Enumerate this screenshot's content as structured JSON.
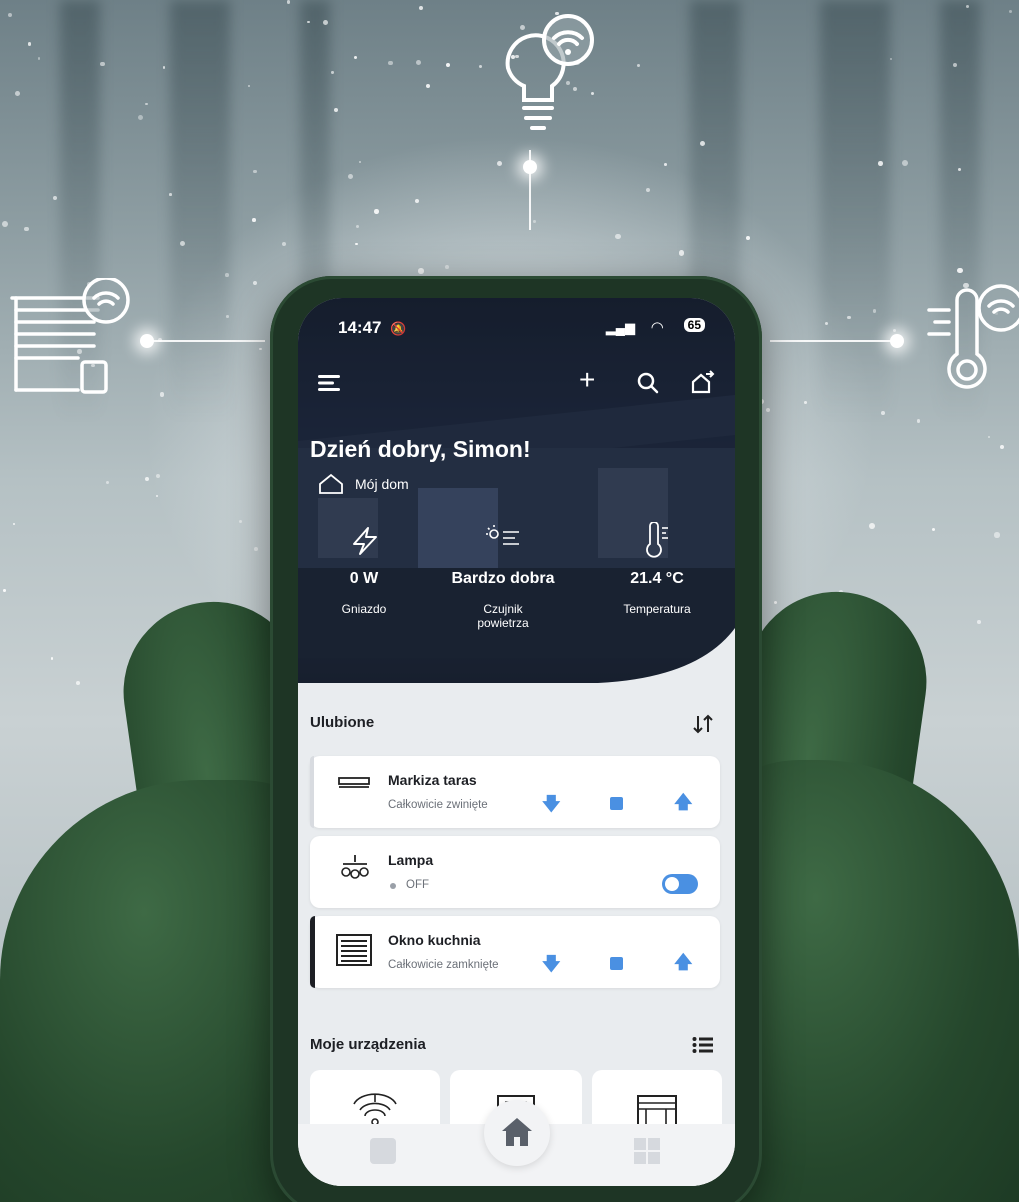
{
  "status": {
    "time": "14:47",
    "battery": "65"
  },
  "header": {
    "greeting": "Dzień dobry, Simon!",
    "home_name": "Mój dom"
  },
  "stats": [
    {
      "icon": "bolt-icon",
      "value": "0 W",
      "label": "Gniazdo"
    },
    {
      "icon": "air-quality-icon",
      "value": "Bardzo dobra",
      "label_line1": "Czujnik",
      "label_line2": "powietrza"
    },
    {
      "icon": "thermometer-icon",
      "value": "21.4 °C",
      "label": "Temperatura"
    }
  ],
  "favorites": {
    "title": "Ulubione",
    "items": [
      {
        "name": "Markiza taras",
        "status": "Całkowicie zwinięte",
        "icon": "awning-icon"
      },
      {
        "name": "Lampa",
        "status": "OFF",
        "icon": "lamp-icon"
      },
      {
        "name": "Okno kuchnia",
        "status": "Całkowicie zamknięte",
        "icon": "roller-blind-icon"
      }
    ]
  },
  "devices": {
    "title": "Moje urządzenia"
  },
  "colors": {
    "accent": "#4a90e2",
    "phone": "#1e3525",
    "glove": "#2a4f31"
  }
}
